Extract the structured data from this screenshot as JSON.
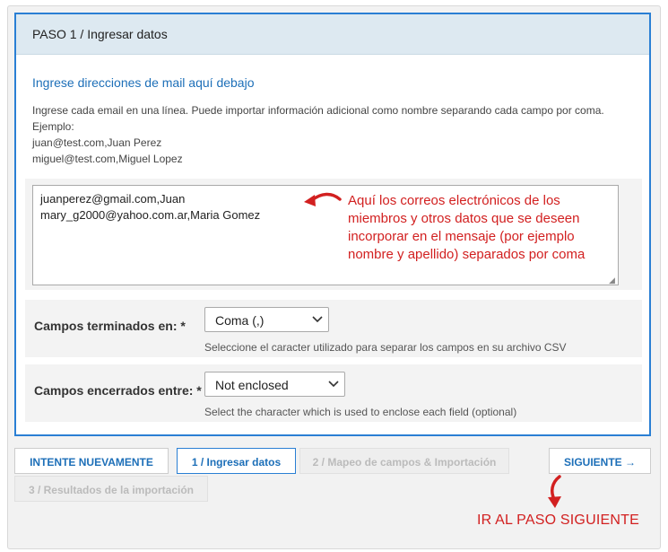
{
  "panel": {
    "step_title": "PASO 1 / Ingresar datos",
    "section_title": "Ingrese direcciones de mail aquí debajo",
    "instructions": [
      "Ingrese cada email en una línea. Puede importar información adicional como nombre separando cada campo por coma.",
      "Ejemplo:",
      "juan@test.com,Juan Perez",
      "miguel@test.com,Miguel Lopez"
    ]
  },
  "email_textarea": {
    "value": "juanperez@gmail.com,Juan\nmary_g2000@yahoo.com.ar,Maria Gomez"
  },
  "annotation_textarea": [
    "Aquí los correos electrónicos de los",
    "miembros y otros datos que se deseen",
    "incorporar en el mensaje (por ejemplo",
    "nombre y apellido) separados por coma"
  ],
  "fields": {
    "terminated": {
      "label": "Campos terminados en: *",
      "selected": "Coma (,)",
      "help": "Seleccione el caracter utilizado para separar los campos en su archivo CSV"
    },
    "enclosed": {
      "label": "Campos encerrados entre: *",
      "selected": "Not enclosed",
      "help": "Select the character which is used to enclose each field (optional)"
    }
  },
  "buttons": {
    "retry": "INTENTE NUEVAMENTE",
    "step1": "1 / Ingresar datos",
    "step2": "2 / Mapeo de campos & Importación",
    "step3": "3 / Resultados de la importación",
    "next": "SIGUIENTE →"
  },
  "annotation_next": "IR AL PASO SIGUIENTE",
  "colors": {
    "accent": "#1d6fb8",
    "panel_border": "#2a7fd4",
    "annotation": "#d22020"
  },
  "icons": {
    "select_caret": "chevron-down-icon",
    "annotation_arrow": "curved-arrow-left-icon",
    "next_arrow": "curved-arrow-down-icon"
  }
}
